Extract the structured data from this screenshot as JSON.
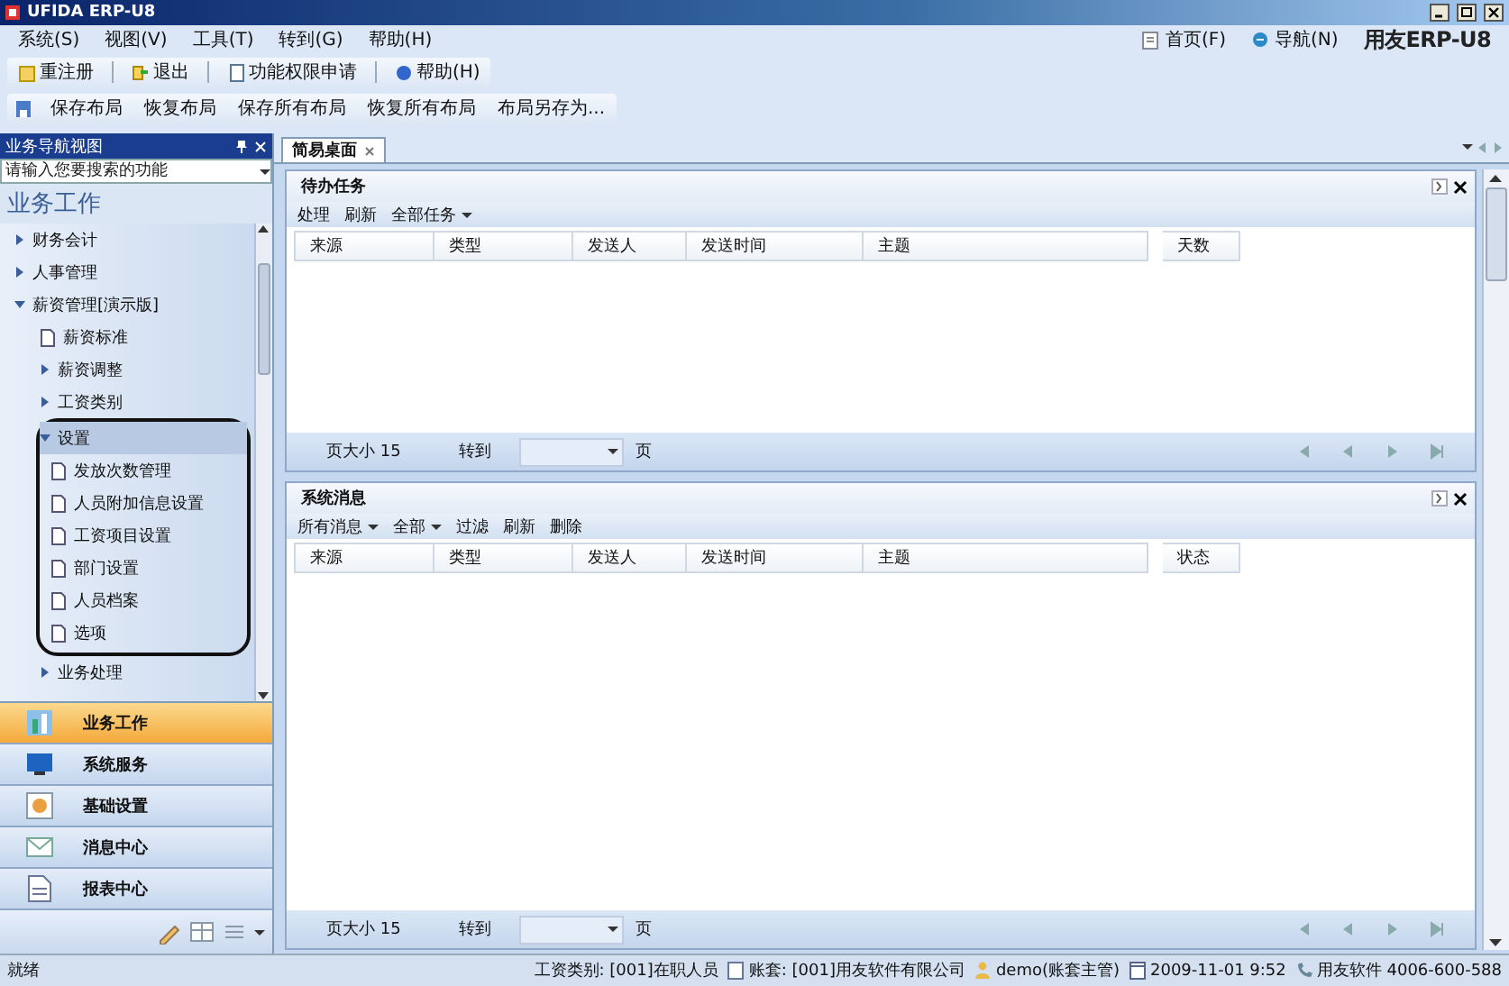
{
  "window": {
    "title": "UFIDA ERP-U8"
  },
  "menu": [
    "系统(S)",
    "视图(V)",
    "工具(T)",
    "转到(G)",
    "帮助(H)"
  ],
  "top_links": [
    "首页(F)",
    "导航(N)"
  ],
  "brand": "用友ERP-U8",
  "toolbar": [
    "重注册",
    "退出",
    "功能权限申请",
    "帮助(H)"
  ],
  "layout_toolbar": [
    "保存布局",
    "恢复布局",
    "保存所有布局",
    "恢复所有布局",
    "布局另存为..."
  ],
  "sidebar": {
    "title": "业务导航视图",
    "search": {
      "placeholder": "请输入您要搜索的功能"
    },
    "section": "业务工作",
    "tree": [
      {
        "label": "财务会计",
        "kind": "folder",
        "expanded": false,
        "selected": false
      },
      {
        "label": "人事管理",
        "kind": "folder",
        "expanded": false,
        "selected": false
      },
      {
        "label": "薪资管理[演示版]",
        "kind": "folder",
        "expanded": true,
        "selected": false,
        "children": [
          {
            "label": "薪资标准",
            "kind": "page",
            "selected": false
          },
          {
            "label": "薪资调整",
            "kind": "folder",
            "expanded": false,
            "selected": false
          },
          {
            "label": "工资类别",
            "kind": "folder",
            "expanded": false,
            "selected": false
          },
          {
            "label": "设置",
            "kind": "folder",
            "expanded": true,
            "selected": true,
            "circled": true,
            "children": [
              {
                "label": "发放次数管理",
                "kind": "page",
                "selected": false
              },
              {
                "label": "人员附加信息设置",
                "kind": "page",
                "selected": false
              },
              {
                "label": "工资项目设置",
                "kind": "page",
                "selected": false
              },
              {
                "label": "部门设置",
                "kind": "page",
                "selected": false
              },
              {
                "label": "人员档案",
                "kind": "page",
                "selected": false
              },
              {
                "label": "选项",
                "kind": "page",
                "selected": false
              }
            ]
          },
          {
            "label": "业务处理",
            "kind": "folder",
            "expanded": false,
            "selected": false
          }
        ]
      }
    ],
    "nav": [
      {
        "label": "业务工作",
        "selected": true
      },
      {
        "label": "系统服务",
        "selected": false
      },
      {
        "label": "基础设置",
        "selected": false
      },
      {
        "label": "消息中心",
        "selected": false
      },
      {
        "label": "报表中心",
        "selected": false
      }
    ]
  },
  "desktop_tab": {
    "label": "简易桌面",
    "selected": true
  },
  "panels": [
    {
      "title": "待办任务",
      "toolbar": [
        {
          "label": "处理",
          "dropdown": false
        },
        {
          "label": "刷新",
          "dropdown": false
        },
        {
          "label": "全部任务",
          "dropdown": true
        }
      ],
      "columns": [
        "来源",
        "类型",
        "发送人",
        "发送时间",
        "主题",
        "天数"
      ],
      "pager": {
        "size_label": "页大小",
        "size": "15",
        "goto": "转到",
        "unit": "页"
      }
    },
    {
      "title": "系统消息",
      "toolbar": [
        {
          "label": "所有消息",
          "dropdown": true
        },
        {
          "label": "全部",
          "dropdown": true
        },
        {
          "label": "过滤",
          "dropdown": false
        },
        {
          "label": "刷新",
          "dropdown": false
        },
        {
          "label": "删除",
          "dropdown": false
        }
      ],
      "columns": [
        "来源",
        "类型",
        "发送人",
        "发送时间",
        "主题",
        "状态"
      ],
      "pager": {
        "size_label": "页大小",
        "size": "15",
        "goto": "转到",
        "unit": "页"
      }
    }
  ],
  "status_bar": {
    "left": "就绪",
    "items": [
      {
        "kind": "text",
        "text": "工资类别: [001]在职人员"
      },
      {
        "kind": "account",
        "text": "账套: [001]用友软件有限公司"
      },
      {
        "kind": "user",
        "text": "demo(账套主管)"
      },
      {
        "kind": "date",
        "text": "2009-11-01 9:52"
      },
      {
        "kind": "phone",
        "text": "用友软件 4006-600-588"
      }
    ]
  }
}
